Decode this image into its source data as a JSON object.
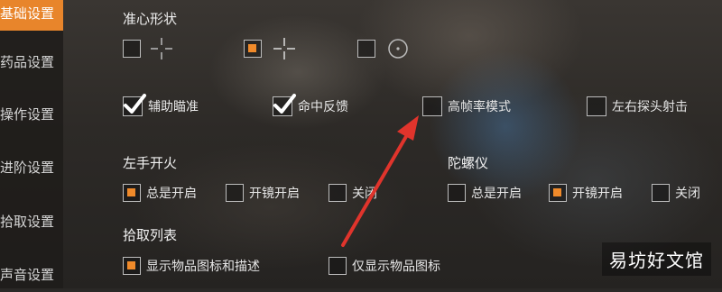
{
  "sidebar": {
    "items": [
      {
        "label": "基础设置",
        "active": true
      },
      {
        "label": "药品设置",
        "active": false
      },
      {
        "label": "操作设置",
        "active": false
      },
      {
        "label": "进阶设置",
        "active": false
      },
      {
        "label": "拾取设置",
        "active": false
      },
      {
        "label": "声音设置",
        "active": false
      }
    ]
  },
  "crosshair": {
    "title": "准心形状",
    "options": [
      {
        "icon": "crosshair-split-icon",
        "selected": false
      },
      {
        "icon": "crosshair-plus-icon",
        "selected": true
      },
      {
        "icon": "crosshair-circle-icon",
        "selected": false
      }
    ]
  },
  "toggles": [
    {
      "label": "辅助瞄准",
      "checked": true
    },
    {
      "label": "命中反馈",
      "checked": true
    },
    {
      "label": "高帧率模式",
      "checked": false
    },
    {
      "label": "左右探头射击",
      "checked": false
    }
  ],
  "left_fire": {
    "title": "左手开火",
    "options": [
      {
        "label": "总是开启",
        "selected": true
      },
      {
        "label": "开镜开启",
        "selected": false
      },
      {
        "label": "关闭",
        "selected": false
      }
    ]
  },
  "gyro": {
    "title": "陀螺仪",
    "options": [
      {
        "label": "总是开启",
        "selected": false
      },
      {
        "label": "开镜开启",
        "selected": true
      },
      {
        "label": "关闭",
        "selected": false
      }
    ]
  },
  "pickup_list": {
    "title": "拾取列表",
    "options": [
      {
        "label": "显示物品图标和描述",
        "selected": true
      },
      {
        "label": "仅显示物品图标",
        "selected": false
      }
    ]
  },
  "watermark": "易坊好文馆",
  "colors": {
    "accent": "#e8852b",
    "arrow": "#e0342c"
  }
}
